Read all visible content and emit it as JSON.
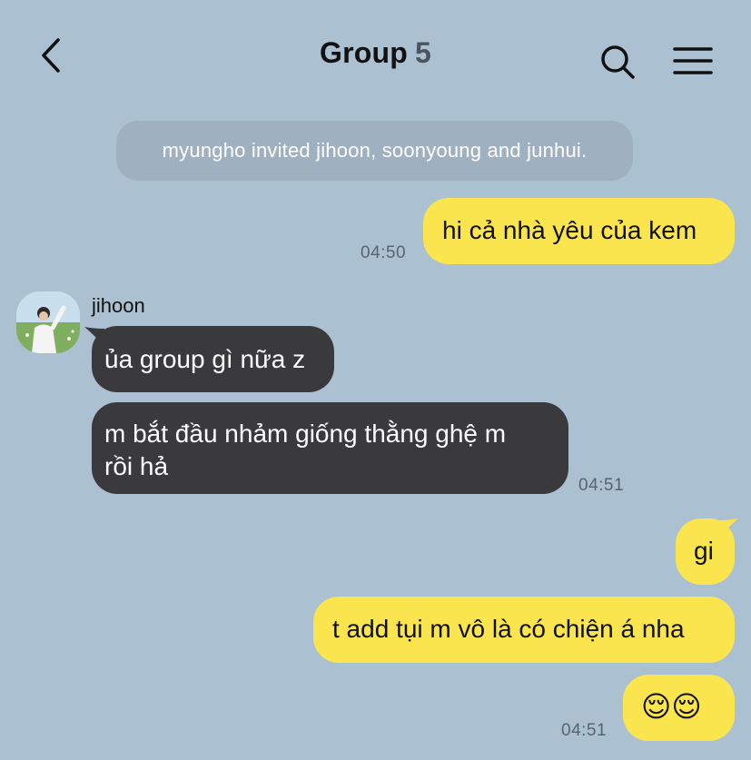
{
  "header": {
    "title": "Group",
    "member_count": "5"
  },
  "system_notice": "myungho invited jihoon, soonyoung and junhui.",
  "messages": [
    {
      "text": "hi cả nhà yêu của kem",
      "time": "04:50"
    },
    {
      "sender": "jihoon",
      "text": "ủa group gì nữa z"
    },
    {
      "line1": "m bắt đầu nhảm giống thằng ghệ m",
      "line2": "rồi hả",
      "time": "04:51"
    },
    {
      "text": "gi"
    },
    {
      "text": "t add tụi m vô là có chiện á nha"
    },
    {
      "text": "😌😌",
      "time": "04:51"
    }
  ],
  "colors": {
    "background": "#abc1d1",
    "my_bubble": "#fbe54e",
    "their_bubble": "#3a3a3c",
    "system_notice": "#9fb1c0"
  },
  "icons": [
    "back-chevron-icon",
    "search-icon",
    "menu-icon"
  ]
}
